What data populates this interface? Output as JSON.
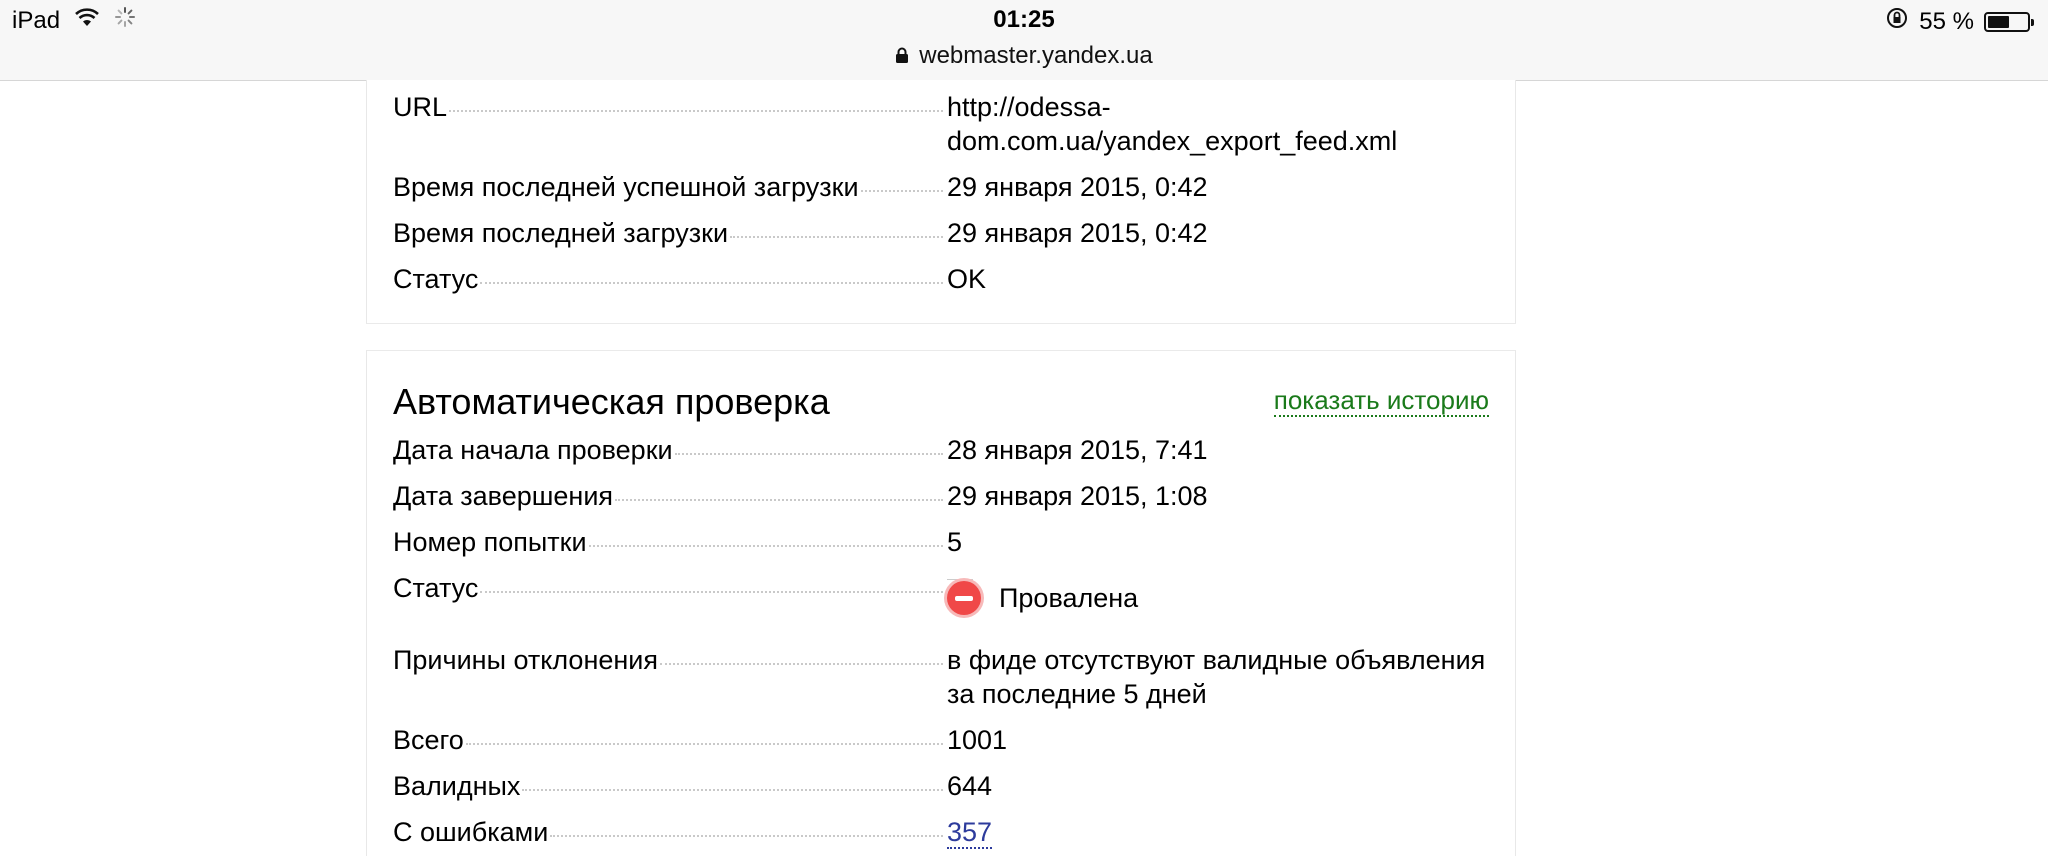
{
  "status_bar": {
    "device": "iPad",
    "time": "01:25",
    "battery_percent": "55 %",
    "battery_level": 0.55
  },
  "url_bar": {
    "domain": "webmaster.yandex.ua"
  },
  "feed_card": {
    "rows": [
      {
        "label": "URL",
        "value": "http://odessa-dom.com.ua/yandex_export_feed.xml"
      },
      {
        "label": "Время последней успешной загрузки",
        "value": "29 января 2015, 0:42"
      },
      {
        "label": "Время последней загрузки",
        "value": "29 января 2015, 0:42"
      },
      {
        "label": "Статус",
        "value": "OK"
      }
    ]
  },
  "check_card": {
    "title": "Автоматическая проверка",
    "history_link": "показать историю",
    "rows": [
      {
        "label": "Дата начала проверки",
        "value": "28 января 2015, 7:41"
      },
      {
        "label": "Дата завершения",
        "value": "29 января 2015, 1:08"
      },
      {
        "label": "Номер попытки",
        "value": "5"
      },
      {
        "label": "Статус",
        "value": "Провалена"
      },
      {
        "label": "Причины отклонения",
        "value": "в фиде отсутствуют валидные объявления за последние 5 дней"
      },
      {
        "label": "Всего",
        "value": "1001"
      },
      {
        "label": "Валидных",
        "value": "644"
      },
      {
        "label": "С ошибками",
        "value": "357"
      }
    ]
  },
  "colors": {
    "history_link": "#1a7a1a",
    "error_link": "#2d3b9c",
    "fail_icon": "#f04848"
  }
}
